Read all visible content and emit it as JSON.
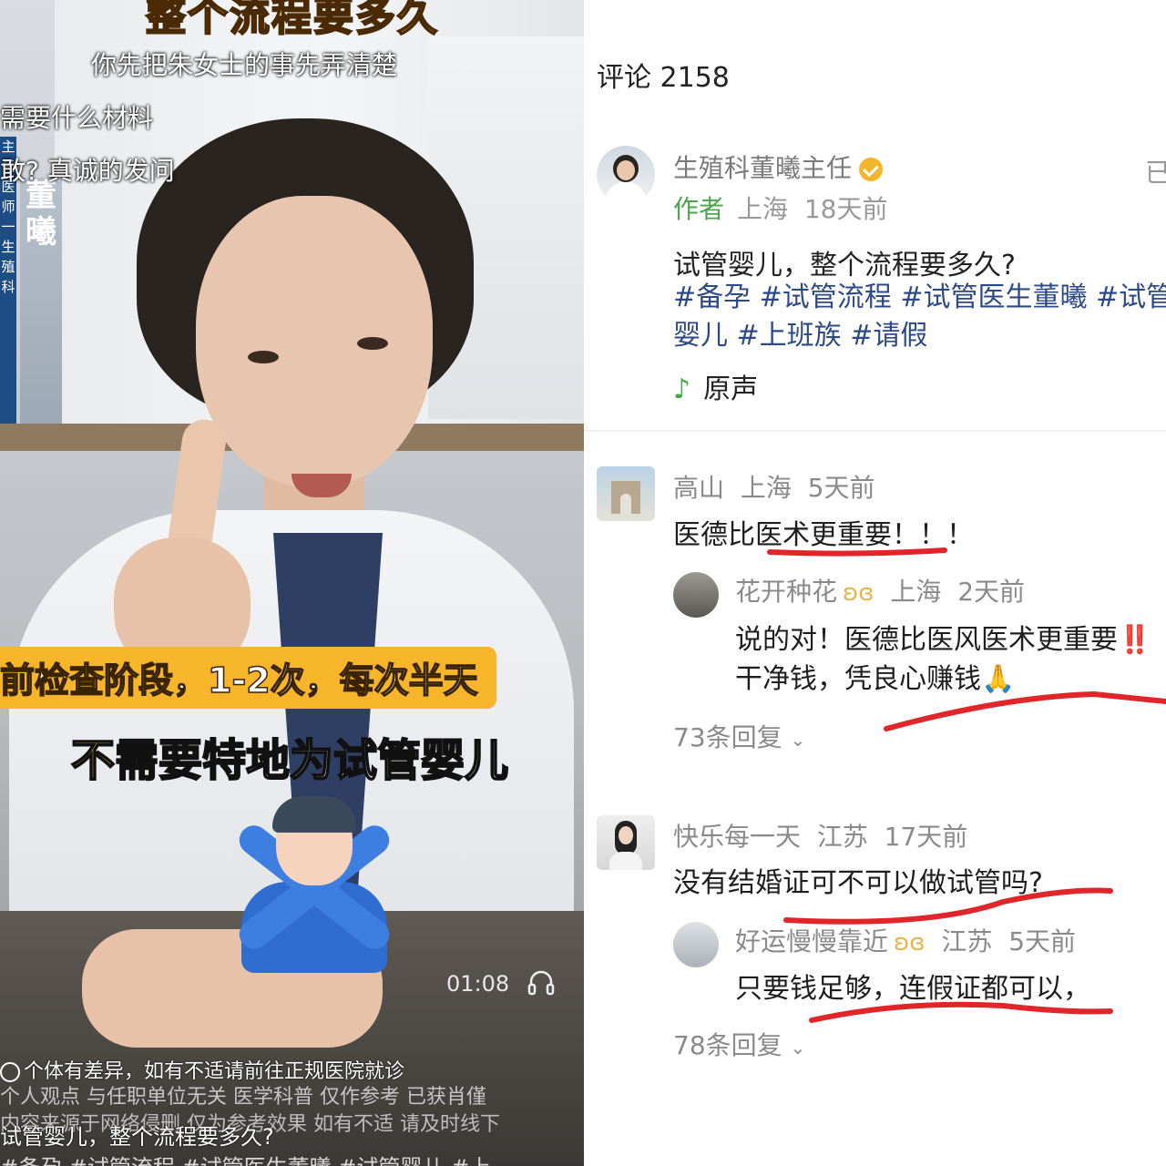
{
  "video": {
    "title_top": "整个流程要多久",
    "subtitle_top": "你先把朱女士的事先弄清楚",
    "side_line1": "需要什么材料",
    "side_line2": "敢? 真诚的发问",
    "name_plate": [
      "董",
      "曦"
    ],
    "banner_text": [
      "主",
      "任",
      "医",
      "师",
      "一",
      "生",
      "殖",
      "科"
    ],
    "stage_banner": "前检查阶段，1-2次，每次半天",
    "caption_highlight": "不需要",
    "caption_rest": "特地为试管婴儿",
    "time": "01:08",
    "disclaimer": "个体有差异，如有不适请前往正规医院就诊",
    "footer_line1": "个人观点 与任职单位无关 医学科普 仅作参考 已获肖僅",
    "footer_line2": "内容来源于网络侵删 仅为参考效果 如有不适 请及时线下",
    "footer_caption": "试管婴儿，整个流程要多久?",
    "footer_tags": "#备孕 #试管流程 #试管医生董曦 #试管婴儿 #上"
  },
  "comments_panel": {
    "count_label": "评论 2158",
    "author": {
      "name": "生殖科董曦主任",
      "follow_partial": "已",
      "tag": "作者",
      "location": "上海",
      "time": "18天前",
      "post_title": "试管婴儿，整个流程要多久?",
      "post_tags": "#备孕 #试管流程 #试管医生董曦 #试管婴儿 #上班族 #请假",
      "audio_label": "原声"
    },
    "comments": [
      {
        "user": "高山",
        "location": "上海",
        "time": "5天前",
        "text": "医德比医术更重要！！！",
        "reply": {
          "user": "花开种花",
          "location": "上海",
          "time": "2天前",
          "text_line1": "说的对！医德比医风医术更重要‼️",
          "text_line2": "干净钱，凭良心赚钱🙏"
        },
        "more": "73条回复"
      },
      {
        "user": "快乐每一天",
        "location": "江苏",
        "time": "17天前",
        "text": "没有结婚证可不可以做试管吗?",
        "reply": {
          "user": "好运慢慢靠近",
          "location": "江苏",
          "time": "5天前",
          "text_line1": "只要钱足够，连假证都可以，"
        },
        "more": "78条回复"
      }
    ]
  },
  "colors": {
    "accent_green": "#4aa64a",
    "tag_blue": "#2c4a88",
    "annotation_red": "#e0262a",
    "video_banner_yellow": "#f7b52b"
  }
}
